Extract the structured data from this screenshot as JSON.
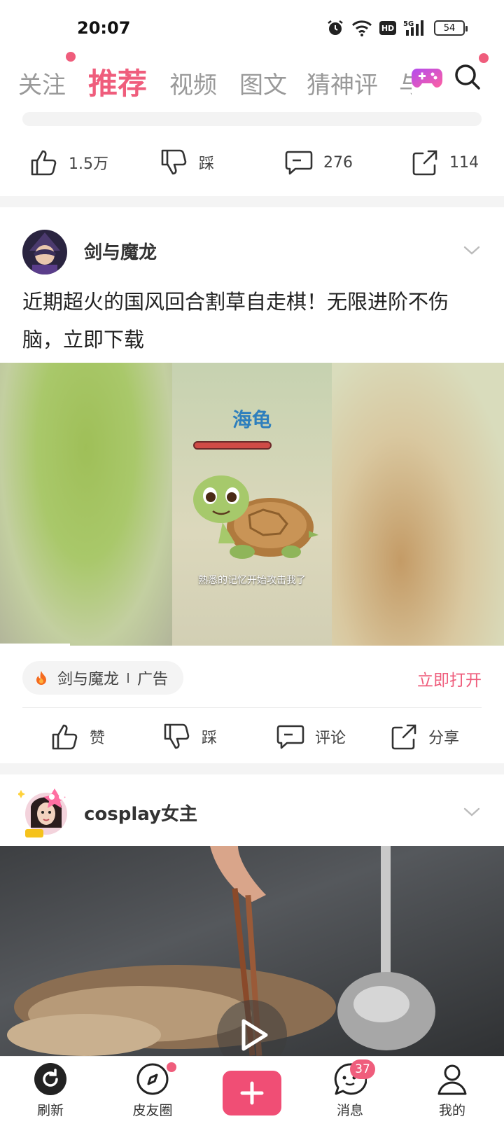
{
  "status_bar": {
    "time": "20:07",
    "battery": "54",
    "hd": "HD",
    "network": "5G"
  },
  "tabs": [
    {
      "label": "关注"
    },
    {
      "label": "推荐"
    },
    {
      "label": "视频"
    },
    {
      "label": "图文"
    },
    {
      "label": "猜神评"
    },
    {
      "label": "与"
    }
  ],
  "prev_post": {
    "likes": "1.5万",
    "dislike": "踩",
    "comments": "276",
    "shares": "114"
  },
  "ad_post": {
    "author": "剑与魔龙",
    "text": "近期超火的国风回合割草自走棋！无限进阶不伤脑，立即下载",
    "media_title": "海龟",
    "media_subtitle": "熟悉的记忆开始攻击我了",
    "ad_name": "剑与魔龙",
    "ad_label": "广告",
    "open_label": "立即打开",
    "like": "赞",
    "dislike": "踩",
    "comment": "评论",
    "share": "分享"
  },
  "next_post": {
    "author": "cosplay女主"
  },
  "bottom_nav": {
    "refresh": "刷新",
    "circle": "皮友圈",
    "messages": "消息",
    "messages_badge": "37",
    "mine": "我的"
  },
  "colors": {
    "accent": "#ef5d7c",
    "add_button": "#f04e75"
  }
}
